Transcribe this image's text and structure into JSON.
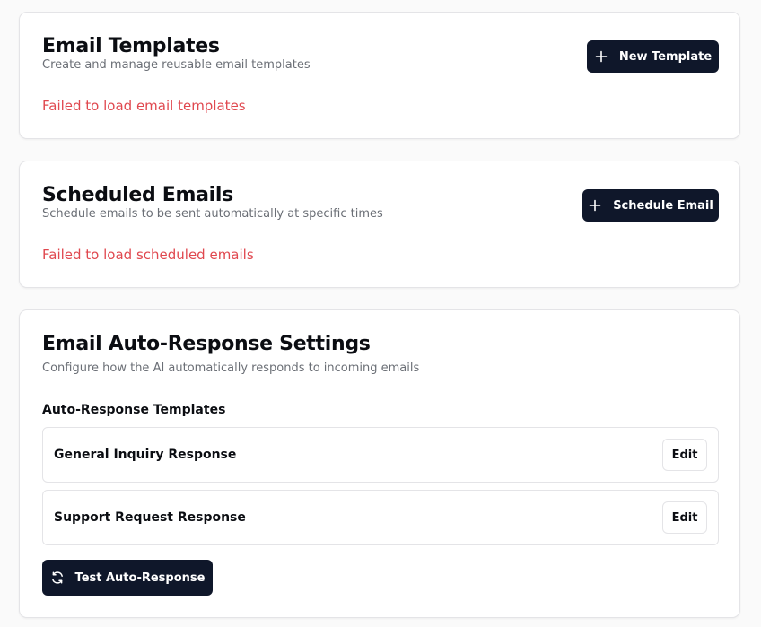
{
  "templates_card": {
    "title": "Email Templates",
    "subtitle": "Create and manage reusable email templates",
    "new_button_label": "New Template",
    "error": "Failed to load email templates"
  },
  "scheduled_card": {
    "title": "Scheduled Emails",
    "subtitle": "Schedule emails to be sent automatically at specific times",
    "schedule_button_label": "Schedule Email",
    "error": "Failed to load scheduled emails"
  },
  "auto_response_card": {
    "title": "Email Auto-Response Settings",
    "subtitle": "Configure how the AI automatically responds to incoming emails",
    "section_label": "Auto-Response Templates",
    "templates": [
      {
        "name": "General Inquiry Response",
        "edit_label": "Edit"
      },
      {
        "name": "Support Request Response",
        "edit_label": "Edit"
      }
    ],
    "test_button_label": "Test Auto-Response"
  },
  "icons": {
    "plus": "plus-icon",
    "refresh": "refresh-icon"
  },
  "colors": {
    "primary_button": "#0f172a",
    "error_text": "#e0484f",
    "muted_text": "#6b6f76",
    "border": "#e4e4e7"
  }
}
